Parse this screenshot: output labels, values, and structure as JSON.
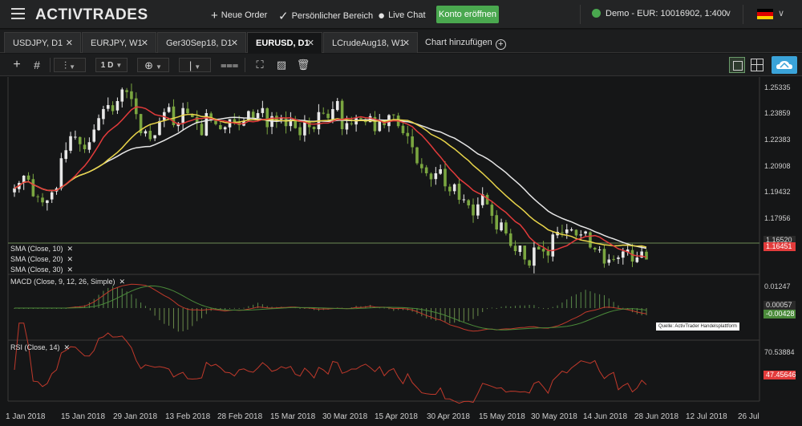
{
  "header": {
    "logo": "ACTIVTRADES",
    "new_order": "Neue Order",
    "personal_area": "Persönlicher Bereich",
    "live_chat": "Live Chat",
    "open_account": "Konto eröffnen",
    "account": "Demo - EUR: 10016902, 1:400"
  },
  "tabs": [
    {
      "label": "USDJPY, D1"
    },
    {
      "label": "EURJPY, W1"
    },
    {
      "label": "Ger30Sep18, D1"
    },
    {
      "label": "EURUSD, D1"
    },
    {
      "label": "LCrudeAug18, W1"
    }
  ],
  "add_chart_label": "Chart hinzufügen",
  "toolbar": {
    "timeframe": "1 D"
  },
  "price_axis": [
    "1.25335",
    "1.23859",
    "1.22383",
    "1.20908",
    "1.19432",
    "1.17956",
    "1.16480"
  ],
  "price_tags": {
    "main_top": "1.16520",
    "main_current": "1.16451"
  },
  "indicators": {
    "sma10": "SMA (Close, 10)",
    "sma20": "SMA (Close, 20)",
    "sma30": "SMA (Close, 30)",
    "macd": "MACD (Close, 9, 12, 26, Simple)",
    "rsi": "RSI (Close, 14)"
  },
  "macd_axis": {
    "top": "0.01247",
    "tag1": "0.00057",
    "tag2": "-0.00428"
  },
  "rsi_axis": {
    "top": "70.53884",
    "tag1": "47.45646",
    "tag2": "47.45646"
  },
  "source_note": "Quelle: ActivTrader Handelsplattform",
  "dates": [
    "1 Jan 2018",
    "15 Jan 2018",
    "29 Jan 2018",
    "13 Feb 2018",
    "28 Feb 2018",
    "15 Mar 2018",
    "30 Mar 2018",
    "15 Apr 2018",
    "30 Apr 2018",
    "15 May 2018",
    "30 May 2018",
    "14 Jun 2018",
    "28 Jun 2018",
    "12 Jul 2018",
    "26 Jul"
  ],
  "colors": {
    "sma10": "#e33b3b",
    "sma20": "#e8d44a",
    "sma30": "#e6e6e6",
    "candle_up": "#e8e8e8",
    "candle_down": "#7aa640",
    "accent_green": "#4aa84f",
    "cloud_blue": "#3aa3d9"
  },
  "chart_data": {
    "type": "candlestick",
    "symbol": "EURUSD",
    "timeframe": "D1",
    "ylim": [
      1.16,
      1.256
    ],
    "close_series": [
      1.2005,
      1.2032,
      1.2068,
      1.2048,
      1.1965,
      1.1962,
      1.1935,
      1.1945,
      1.1985,
      1.2005,
      1.2155,
      1.2195,
      1.2265,
      1.2262,
      1.2225,
      1.22,
      1.2235,
      1.2298,
      1.2355,
      1.24,
      1.242,
      1.239,
      1.244,
      1.2498,
      1.2485,
      1.245,
      1.2375,
      1.228,
      1.229,
      1.225,
      1.227,
      1.234,
      1.2385,
      1.241,
      1.232,
      1.233,
      1.2405,
      1.238,
      1.236,
      1.233,
      1.227,
      1.238,
      1.2345,
      1.2325,
      1.23,
      1.231,
      1.235,
      1.2335,
      1.232,
      1.234,
      1.239,
      1.2355,
      1.238,
      1.2405,
      1.231,
      1.2365,
      1.2345,
      1.2355,
      1.2315,
      1.2345,
      1.2305,
      1.227,
      1.234,
      1.231,
      1.23,
      1.2385,
      1.238,
      1.2355,
      1.24,
      1.244,
      1.23,
      1.233,
      1.2325,
      1.2355,
      1.235,
      1.2335,
      1.2365,
      1.229,
      1.234,
      1.232,
      1.237,
      1.237,
      1.2315,
      1.228,
      1.2265,
      1.221,
      1.213,
      1.2105,
      1.208,
      1.205,
      1.208,
      1.21,
      1.2015,
      1.199,
      1.2025,
      1.1948,
      1.195,
      1.192,
      1.187,
      1.1925,
      1.1975,
      1.1925,
      1.1868,
      1.18,
      1.1835,
      1.178,
      1.1718,
      1.1692,
      1.172,
      1.165,
      1.162,
      1.171,
      1.17,
      1.169,
      1.167,
      1.1775,
      1.1788,
      1.1785,
      1.18,
      1.18,
      1.177,
      1.1775,
      1.179,
      1.171,
      1.17,
      1.17,
      1.163,
      1.165,
      1.165,
      1.166,
      1.169,
      1.17,
      1.164,
      1.166,
      1.169,
      1.165
    ]
  }
}
